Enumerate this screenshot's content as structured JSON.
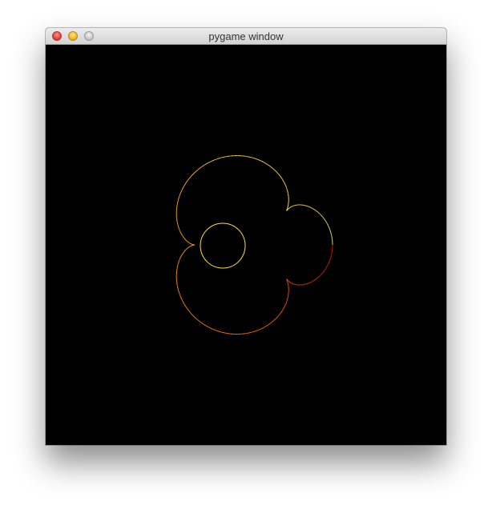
{
  "window": {
    "title": "pygame window",
    "colors": {
      "titlebar": "#d8d8d8",
      "canvas_background": "#000000",
      "close": "#e0443a",
      "minimize": "#f2b527",
      "zoom": "#c8c8c8"
    }
  },
  "curve": {
    "description_icon": "epicycloid-curve",
    "gradient_colors": [
      "#e0100a",
      "#ff6a00",
      "#ffa020",
      "#ffe040",
      "#ffff80"
    ]
  }
}
